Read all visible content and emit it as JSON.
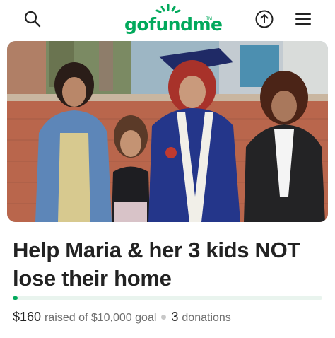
{
  "header": {
    "logo_text": "gofundme",
    "logo_tm": "TM",
    "search_icon": "search-icon",
    "share_icon": "share-icon",
    "menu_icon": "hamburger-menu-icon"
  },
  "campaign": {
    "photo_icon": "campaign-photo",
    "title": "Help Maria & her 3 kids NOT lose their home",
    "raised_amount": "$160",
    "raised_text": "raised of $10,000 goal",
    "donations_count": "3",
    "donations_label": "donations",
    "progress_fraction": 0.016
  },
  "colors": {
    "brand_green": "#02a95c",
    "progress_track": "#e9f4ee",
    "text_dark": "#222222",
    "text_muted": "#6f6f6f"
  }
}
